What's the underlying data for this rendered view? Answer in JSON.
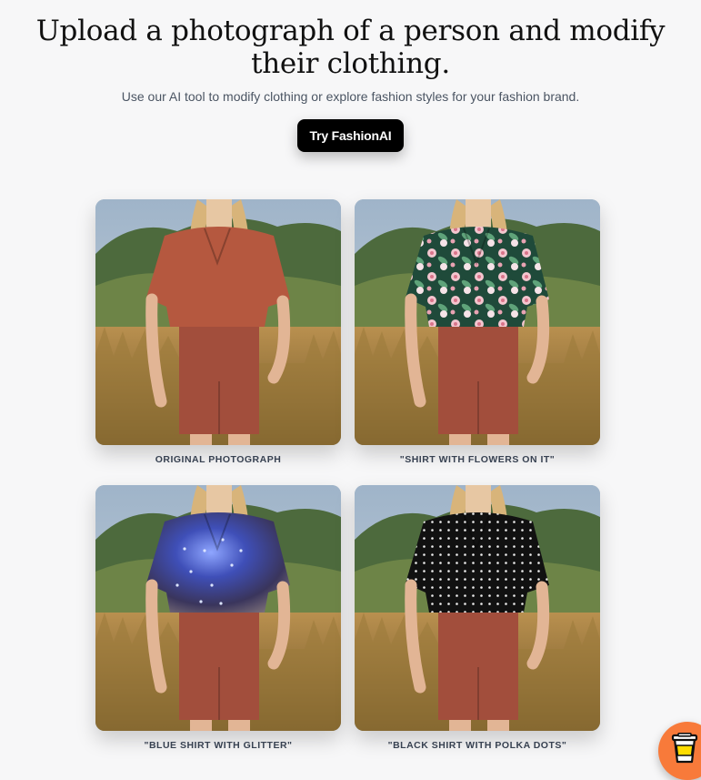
{
  "hero": {
    "title": "Upload a photograph of a person and modify their clothing.",
    "subtitle": "Use our AI tool to modify clothing or explore fashion styles for your fashion brand.",
    "cta_label": "Try FashionAI"
  },
  "gallery": [
    {
      "caption": "ORIGINAL PHOTOGRAPH",
      "shirt_color": "#b5583f",
      "pattern": "plain"
    },
    {
      "caption": "\"SHIRT WITH FLOWERS ON IT\"",
      "shirt_color": "#1f4a3a",
      "pattern": "flowers"
    },
    {
      "caption": "\"BLUE SHIRT WITH GLITTER\"",
      "shirt_color": "#3d3a63",
      "pattern": "glitter"
    },
    {
      "caption": "\"BLACK SHIRT WITH POLKA DOTS\"",
      "shirt_color": "#111111",
      "pattern": "polka"
    }
  ],
  "colors": {
    "cta_background": "#000000",
    "coffee_button": "#f87a3a",
    "shorts": "#a24e3c"
  },
  "floating_button": {
    "icon": "coffee-cup-icon"
  }
}
